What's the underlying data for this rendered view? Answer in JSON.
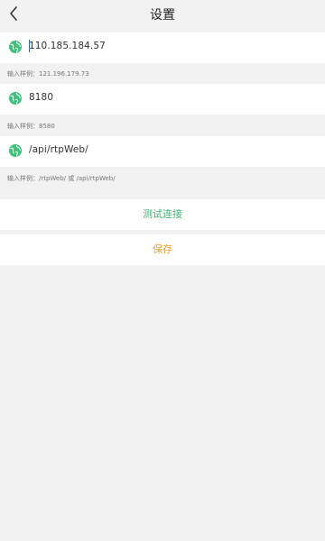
{
  "header": {
    "title": "设置"
  },
  "fields": [
    {
      "value": "110.185.184.57",
      "hint": "输入样例：121.196.179.73"
    },
    {
      "value": "8180",
      "hint": "输入样例：8580"
    },
    {
      "value": "/api/rtpWeb/",
      "hint": "输入样例：/rtpWeb/ 或 /api/rtpWeb/"
    }
  ],
  "actions": {
    "test_label": "测试连接",
    "save_label": "保存"
  },
  "colors": {
    "icon_green": "#3cc27a",
    "test_green": "#3cb371",
    "save_orange": "#f0a030",
    "background": "#f2f2f2"
  },
  "icons": {
    "back": "chevron-left-icon",
    "field": "globe-icon"
  }
}
